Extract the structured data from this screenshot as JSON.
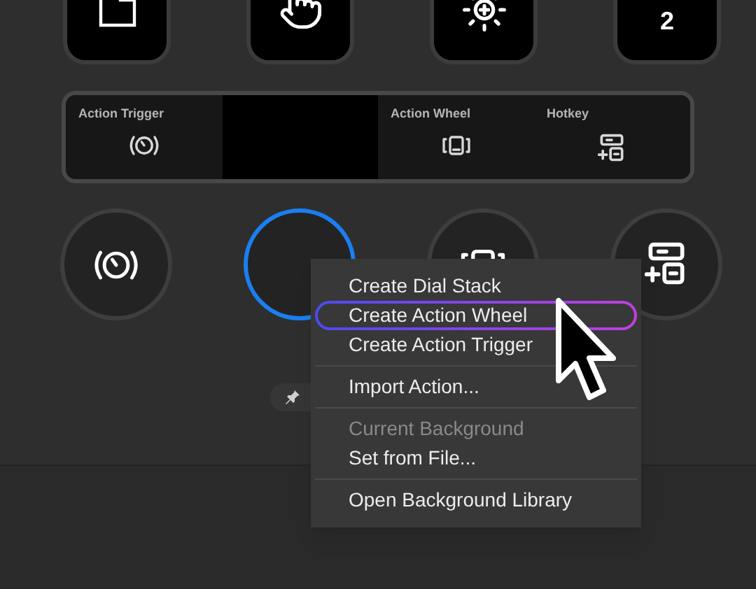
{
  "keys": [
    {
      "kind": "folder"
    },
    {
      "kind": "hand"
    },
    {
      "kind": "brightness"
    },
    {
      "kind": "text",
      "label": "2"
    }
  ],
  "strip": [
    {
      "kind": "trigger",
      "label": "Action Trigger"
    },
    {
      "kind": "empty"
    },
    {
      "kind": "wheel",
      "label": "Action Wheel"
    },
    {
      "kind": "hotkey",
      "label": "Hotkey"
    }
  ],
  "dials": [
    {
      "kind": "trigger",
      "selected": false
    },
    {
      "kind": "empty",
      "selected": true
    },
    {
      "kind": "wheel",
      "selected": false
    },
    {
      "kind": "hotkey",
      "selected": false
    }
  ],
  "context_menu": [
    [
      {
        "label": "Create Dial Stack",
        "disabled": false,
        "selected": false
      },
      {
        "label": "Create Action Wheel",
        "disabled": false,
        "selected": true
      },
      {
        "label": "Create Action Trigger",
        "disabled": false,
        "selected": false
      }
    ],
    [
      {
        "label": "Import Action...",
        "disabled": false,
        "selected": false
      }
    ],
    [
      {
        "label": "Current Background",
        "disabled": true,
        "selected": false
      },
      {
        "label": "Set from File...",
        "disabled": false,
        "selected": false
      }
    ],
    [
      {
        "label": "Open Background Library",
        "disabled": false,
        "selected": false
      }
    ]
  ]
}
